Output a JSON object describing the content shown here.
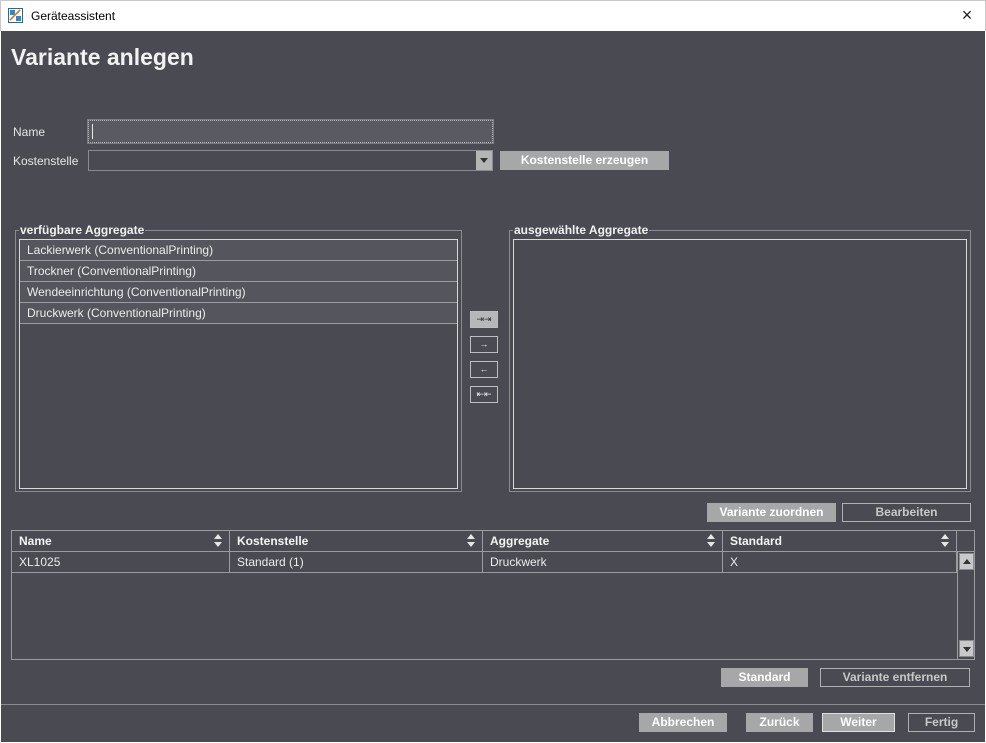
{
  "window": {
    "title": "Geräteassistent",
    "close_glyph": "×"
  },
  "page": {
    "title": "Variante anlegen"
  },
  "form": {
    "name_label": "Name",
    "name_value": "",
    "kostenstelle_label": "Kostenstelle",
    "kostenstelle_value": "",
    "kostenstelle_button": "Kostenstelle erzeugen"
  },
  "available": {
    "title": "verfügbare Aggregate",
    "items": [
      "Lackierwerk (ConventionalPrinting)",
      "Trockner (ConventionalPrinting)",
      "Wendeeinrichtung (ConventionalPrinting)",
      "Druckwerk (ConventionalPrinting)"
    ]
  },
  "selected": {
    "title": "ausgewählte Aggregate",
    "items": []
  },
  "transfer": {
    "add_all": "⇥⇥",
    "add": "→",
    "remove": "←",
    "remove_all": "⇤⇤"
  },
  "variant_actions": {
    "assign": "Variante zuordnen",
    "edit": "Bearbeiten"
  },
  "table": {
    "columns": [
      "Name",
      "Kostenstelle",
      "Aggregate",
      "Standard"
    ],
    "rows": [
      [
        "XL1025",
        "Standard (1)",
        "Druckwerk",
        "X"
      ]
    ]
  },
  "table_actions": {
    "standard": "Standard",
    "remove": "Variante entfernen"
  },
  "footer": {
    "cancel": "Abbrechen",
    "back": "Zurück",
    "next": "Weiter",
    "finish": "Fertig"
  },
  "colors": {
    "background": "#4a4a52",
    "button": "#a7a7a9",
    "accent_text": "#ffffff"
  },
  "icons": {
    "app": "wizard-app-icon",
    "close": "close-icon",
    "dropdown": "chevron-down-icon",
    "sort": "sort-arrows-icon"
  }
}
